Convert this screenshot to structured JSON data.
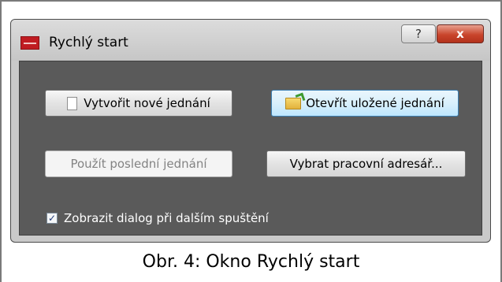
{
  "window": {
    "title": "Rychlý start",
    "help_label": "?",
    "close_label": "x"
  },
  "icons": {
    "app": "app-logo-icon",
    "new_document": "document-icon",
    "open_folder": "folder-open-icon"
  },
  "buttons": {
    "new_meeting": "Vytvořit nové jednání",
    "open_saved": "Otevřít uložené jednání",
    "use_last": "Použít poslední jednání",
    "choose_dir": "Vybrat pracovní adresář..."
  },
  "checkbox": {
    "label": "Zobrazit dialog při dalším spuštění",
    "checked": true,
    "mark": "✓"
  },
  "caption": "Obr. 4: Okno Rychlý start",
  "colors": {
    "client_background": "#5a5a5a",
    "close_button": "#c9452c",
    "open_button_highlight": "#d9f0fc"
  }
}
